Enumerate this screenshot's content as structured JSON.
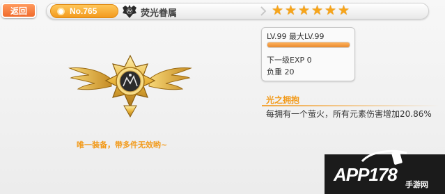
{
  "header": {
    "back_label": "返回",
    "number_label": "No.765",
    "item_name": "荧光眷属",
    "stars": [
      "★",
      "★",
      "★",
      "★",
      "★",
      "★"
    ],
    "accent_color": "#f39a1e"
  },
  "stats": {
    "level_line": "LV.99 最大LV.99",
    "exp_progress": 1.0,
    "exp_line": "下一级EXP 0",
    "load_line": "负重 20"
  },
  "skill": {
    "title": "光之拥抱",
    "description": "每拥有一个萤火，所有元素伤害增加20.86%"
  },
  "equip": {
    "unique_note": "唯一装备，带多件无效哟~"
  },
  "watermark": {
    "brand": "APP178",
    "sub": "手游网"
  },
  "icons": {
    "emblem": "winged-star-emblem-icon",
    "badge": "dark-crest-icon"
  }
}
